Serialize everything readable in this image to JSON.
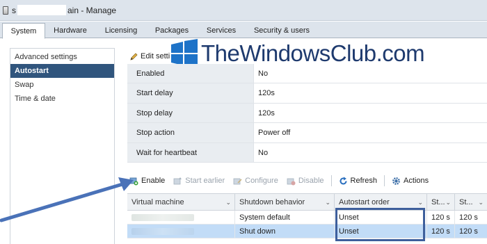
{
  "title": {
    "prefix": "s",
    "suffix": "ain - Manage"
  },
  "tabs": [
    {
      "label": "System",
      "active": true
    },
    {
      "label": "Hardware"
    },
    {
      "label": "Licensing"
    },
    {
      "label": "Packages"
    },
    {
      "label": "Services"
    },
    {
      "label": "Security & users"
    }
  ],
  "sidebar": {
    "items": [
      {
        "label": "Advanced settings"
      },
      {
        "label": "Autostart",
        "active": true
      },
      {
        "label": "Swap"
      },
      {
        "label": "Time & date"
      }
    ]
  },
  "edit_settings": {
    "label": "Edit setti",
    "icon": "pencil-icon"
  },
  "watermark": {
    "text": "TheWindowsClub.com"
  },
  "settings": [
    {
      "key": "Enabled",
      "value": "No"
    },
    {
      "key": "Start delay",
      "value": "120s"
    },
    {
      "key": "Stop delay",
      "value": "120s"
    },
    {
      "key": "Stop action",
      "value": "Power off"
    },
    {
      "key": "Wait for heartbeat",
      "value": "No"
    }
  ],
  "toolbar": {
    "enable": "Enable",
    "start_earlier": "Start earlier",
    "configure": "Configure",
    "disable": "Disable",
    "refresh": "Refresh",
    "actions": "Actions"
  },
  "grid": {
    "headers": [
      "Virtual machine",
      "Shutdown behavior",
      "Autostart order",
      "St...",
      "St..."
    ],
    "rows": [
      {
        "vm": "",
        "shutdown": "System default",
        "order": "Unset",
        "st1": "120 s",
        "st2": "120 s",
        "selected": false
      },
      {
        "vm": "",
        "shutdown": "Shut down",
        "order": "Unset",
        "st1": "120 s",
        "st2": "120 s",
        "selected": true
      }
    ]
  },
  "colors": {
    "accent": "#30557d",
    "selection": "#c2dcf7",
    "highlight_box": "#3e5f9c",
    "arrow": "#4a72b8"
  }
}
